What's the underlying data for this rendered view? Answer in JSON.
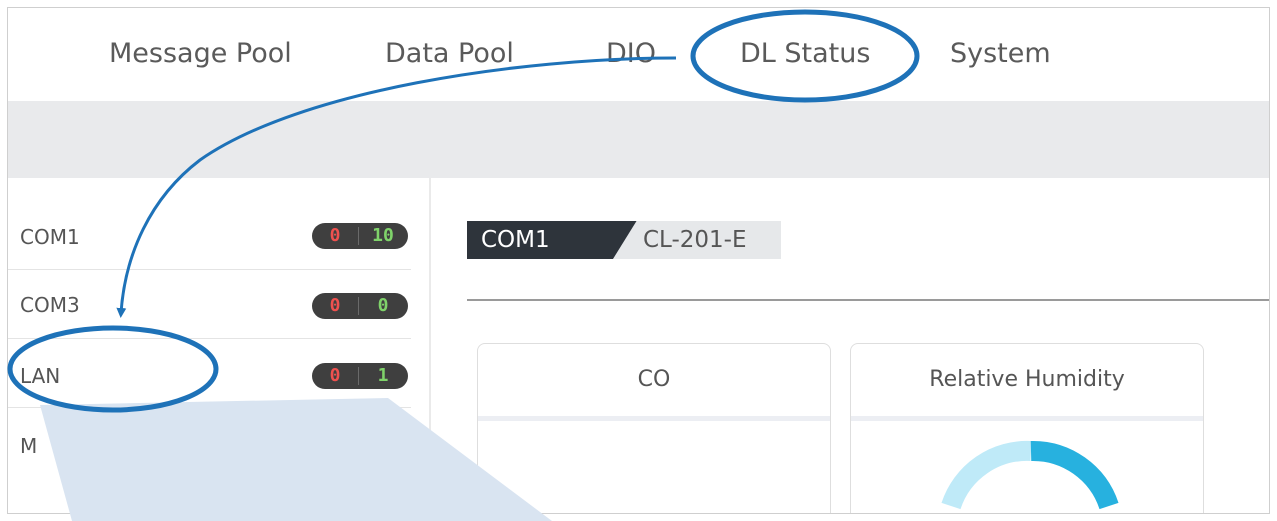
{
  "nav": {
    "items": [
      {
        "label": "Message Pool"
      },
      {
        "label": "Data Pool"
      },
      {
        "label": "DIO"
      },
      {
        "label": "DL Status"
      },
      {
        "label": "System"
      }
    ]
  },
  "sidebar": {
    "items": [
      {
        "label": "COM1",
        "err": "0",
        "ok": "10"
      },
      {
        "label": "COM3",
        "err": "0",
        "ok": "0"
      },
      {
        "label": "LAN",
        "err": "0",
        "ok": "1"
      },
      {
        "label": "M"
      }
    ]
  },
  "main": {
    "port_tag": "COM1",
    "device_tag": "CL-201-E",
    "cards": [
      {
        "title": "CO"
      },
      {
        "title": "Relative Humidity"
      }
    ]
  },
  "colors": {
    "annotation": "#1e72b8",
    "callout": "#d9e4f1",
    "error_count": "#f0514f",
    "ok_count": "#7fd36a",
    "gauge": "#27b1df"
  }
}
